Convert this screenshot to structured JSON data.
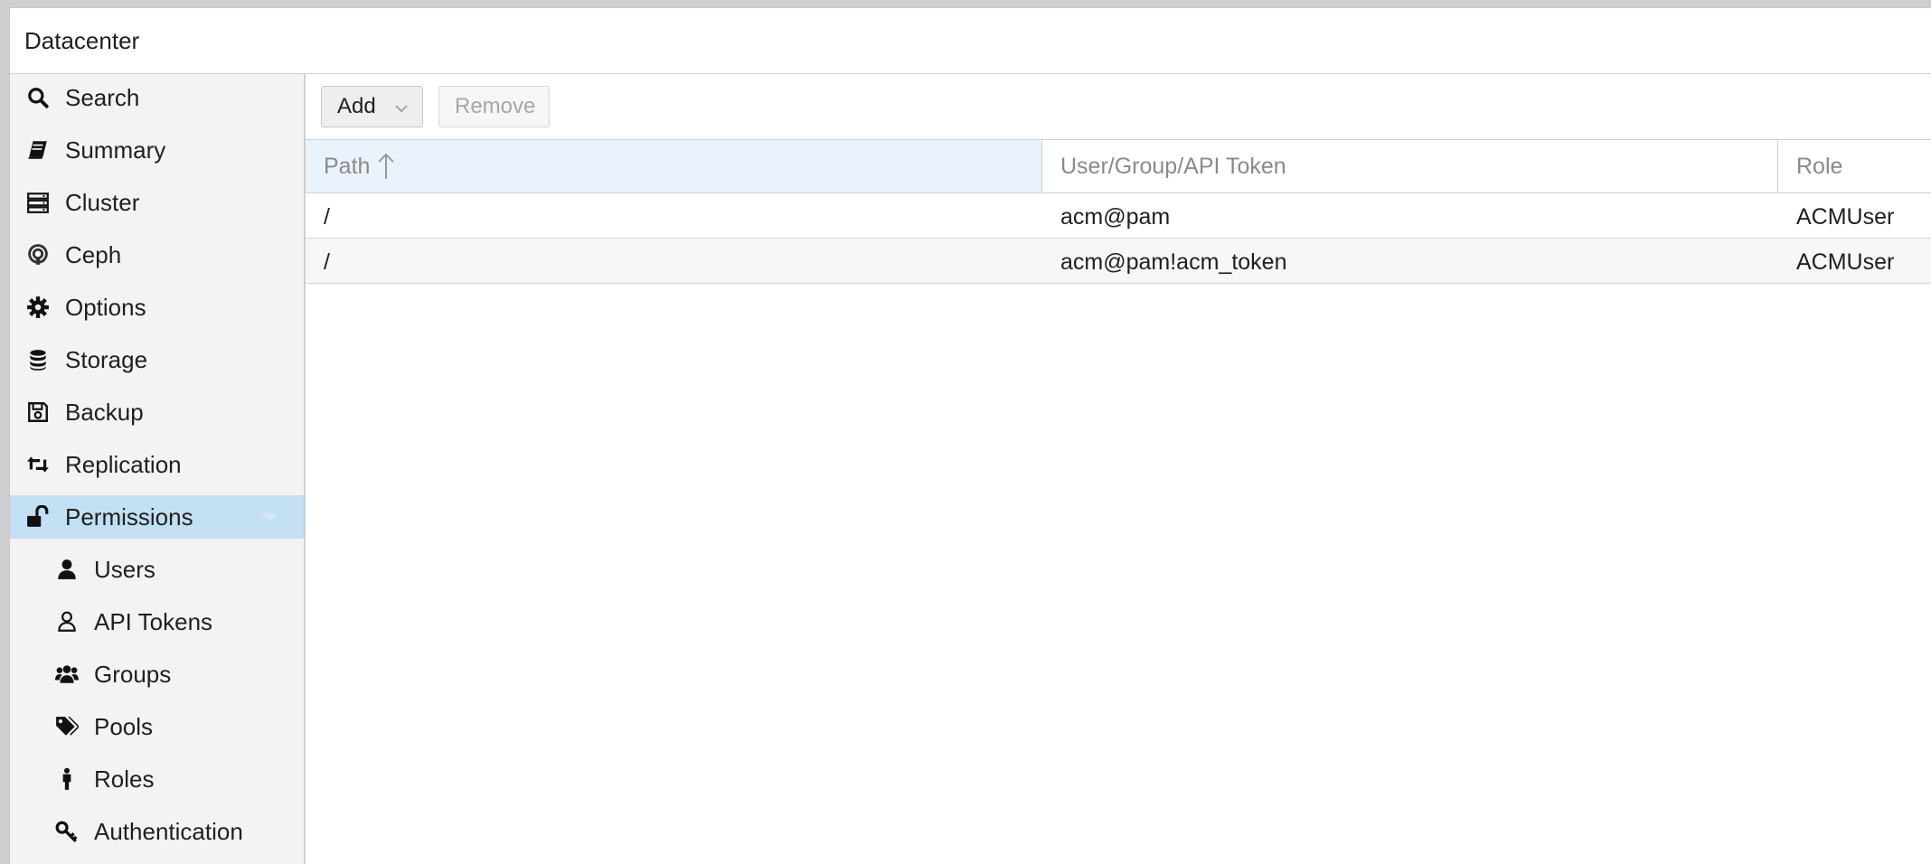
{
  "window": {
    "title": "Datacenter"
  },
  "sidebar": {
    "items": [
      {
        "label": "Search",
        "icon": "search-icon"
      },
      {
        "label": "Summary",
        "icon": "book-icon"
      },
      {
        "label": "Cluster",
        "icon": "server-icon"
      },
      {
        "label": "Ceph",
        "icon": "ceph-icon"
      },
      {
        "label": "Options",
        "icon": "gear-icon"
      },
      {
        "label": "Storage",
        "icon": "database-icon"
      },
      {
        "label": "Backup",
        "icon": "floppy-icon"
      },
      {
        "label": "Replication",
        "icon": "retweet-icon"
      },
      {
        "label": "Permissions",
        "icon": "unlock-icon",
        "selected": true
      }
    ],
    "subitems": [
      {
        "label": "Users",
        "icon": "user-icon"
      },
      {
        "label": "API Tokens",
        "icon": "user-outline-icon"
      },
      {
        "label": "Groups",
        "icon": "users-icon"
      },
      {
        "label": "Pools",
        "icon": "tags-icon"
      },
      {
        "label": "Roles",
        "icon": "male-icon"
      },
      {
        "label": "Authentication",
        "icon": "key-icon"
      }
    ]
  },
  "toolbar": {
    "add_label": "Add",
    "remove_label": "Remove"
  },
  "grid": {
    "columns": [
      "Path",
      "User/Group/API Token",
      "Role"
    ],
    "sorted_column": "Path",
    "rows": [
      {
        "path": "/",
        "ugid": "acm@pam",
        "role": "ACMUser"
      },
      {
        "path": "/",
        "ugid": "acm@pam!acm_token",
        "role": "ACMUser"
      }
    ]
  },
  "colors": {
    "selection": "#c3dff4",
    "sorted_header": "#eaf3fb",
    "sidebar_bg": "#f3f3f3"
  }
}
